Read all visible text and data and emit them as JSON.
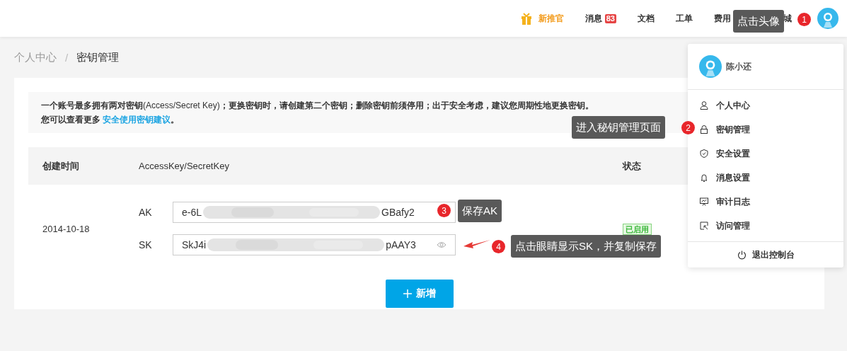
{
  "topbar": {
    "nav": [
      {
        "kind": "promo",
        "label": "新推官"
      },
      {
        "kind": "badge",
        "label": "消息",
        "badge": "83"
      },
      {
        "kind": "plain",
        "label": "文档"
      },
      {
        "kind": "plain",
        "label": "工单"
      },
      {
        "kind": "plain",
        "label": "费用"
      },
      {
        "kind": "plain",
        "label": "城"
      }
    ]
  },
  "breadcrumb": {
    "items": [
      "个人中心",
      "密钥管理"
    ],
    "separator": "/"
  },
  "notice": {
    "text": "**一个账号最多拥有两对密钥**(Access/Secret Key)**；更换密钥时，请创建第二个密钥；删除密钥前须停用；出于安全考虑，建议您周期性地更换密钥。**",
    "more": "您可以查看更多",
    "link": "安全使用密钥建议",
    "end": "。"
  },
  "table": {
    "columns": [
      "创建时间",
      "AccessKey/SecretKey",
      "状态"
    ],
    "rows": [
      {
        "created": "2014-10-18",
        "keys": [
          {
            "label": "AK",
            "start": "e-6L",
            "end": "GBafy2",
            "eye": false
          },
          {
            "label": "SK",
            "start": "SkJ4i",
            "end": "pAAY3",
            "eye": true
          }
        ],
        "status": "已启用"
      }
    ]
  },
  "add_button": "新增",
  "user_menu": {
    "name": "陈小还",
    "items": [
      {
        "label": "个人中心"
      },
      {
        "label": "密钥管理"
      },
      {
        "label": "安全设置"
      },
      {
        "label": "消息设置"
      },
      {
        "label": "审计日志"
      },
      {
        "label": "访问管理"
      }
    ],
    "logout": "退出控制台"
  },
  "annotations": [
    {
      "number": "1",
      "text": "点击头像"
    },
    {
      "number": "2",
      "text": "进入秘钥管理页面"
    },
    {
      "number": "3",
      "text": "保存AK"
    },
    {
      "number": "4",
      "text": "点击眼睛显示SK，并复制保存"
    }
  ]
}
